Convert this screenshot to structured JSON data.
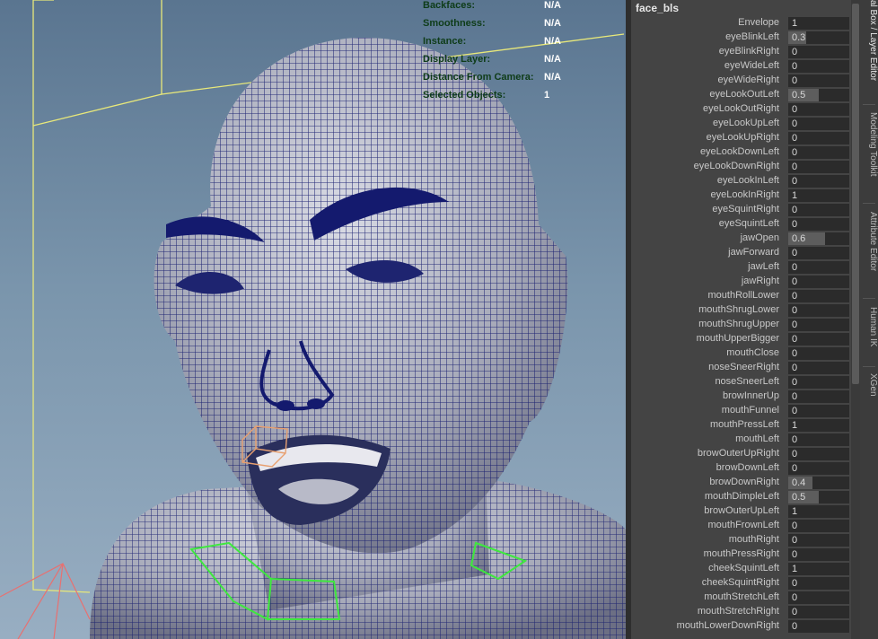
{
  "hud": [
    {
      "label": "Backfaces:",
      "value": "N/A"
    },
    {
      "label": "Smoothness:",
      "value": "N/A"
    },
    {
      "label": "Instance:",
      "value": "N/A"
    },
    {
      "label": "Display Layer:",
      "value": "N/A"
    },
    {
      "label": "Distance From Camera:",
      "value": "N/A"
    },
    {
      "label": "Selected Objects:",
      "value": "1"
    }
  ],
  "panel": {
    "title": "face_bls",
    "attributes": [
      {
        "label": "Envelope",
        "value": "1"
      },
      {
        "label": "eyeBlinkLeft",
        "value": "0.3"
      },
      {
        "label": "eyeBlinkRight",
        "value": "0"
      },
      {
        "label": "eyeWideLeft",
        "value": "0"
      },
      {
        "label": "eyeWideRight",
        "value": "0"
      },
      {
        "label": "eyeLookOutLeft",
        "value": "0.5"
      },
      {
        "label": "eyeLookOutRight",
        "value": "0"
      },
      {
        "label": "eyeLookUpLeft",
        "value": "0"
      },
      {
        "label": "eyeLookUpRight",
        "value": "0"
      },
      {
        "label": "eyeLookDownLeft",
        "value": "0"
      },
      {
        "label": "eyeLookDownRight",
        "value": "0"
      },
      {
        "label": "eyeLookInLeft",
        "value": "0"
      },
      {
        "label": "eyeLookInRight",
        "value": "1"
      },
      {
        "label": "eyeSquintRight",
        "value": "0"
      },
      {
        "label": "eyeSquintLeft",
        "value": "0"
      },
      {
        "label": "jawOpen",
        "value": "0.6"
      },
      {
        "label": "jawForward",
        "value": "0"
      },
      {
        "label": "jawLeft",
        "value": "0"
      },
      {
        "label": "jawRight",
        "value": "0"
      },
      {
        "label": "mouthRollLower",
        "value": "0"
      },
      {
        "label": "mouthShrugLower",
        "value": "0"
      },
      {
        "label": "mouthShrugUpper",
        "value": "0"
      },
      {
        "label": "mouthUpperBigger",
        "value": "0"
      },
      {
        "label": "mouthClose",
        "value": "0"
      },
      {
        "label": "noseSneerRight",
        "value": "0"
      },
      {
        "label": "noseSneerLeft",
        "value": "0"
      },
      {
        "label": "browInnerUp",
        "value": "0"
      },
      {
        "label": "mouthFunnel",
        "value": "0"
      },
      {
        "label": "mouthPressLeft",
        "value": "1"
      },
      {
        "label": "mouthLeft",
        "value": "0"
      },
      {
        "label": "browOuterUpRight",
        "value": "0"
      },
      {
        "label": "browDownLeft",
        "value": "0"
      },
      {
        "label": "browDownRight",
        "value": "0.4"
      },
      {
        "label": "mouthDimpleLeft",
        "value": "0.5"
      },
      {
        "label": "browOuterUpLeft",
        "value": "1"
      },
      {
        "label": "mouthFrownLeft",
        "value": "0"
      },
      {
        "label": "mouthRight",
        "value": "0"
      },
      {
        "label": "mouthPressRight",
        "value": "0"
      },
      {
        "label": "cheekSquintLeft",
        "value": "1"
      },
      {
        "label": "cheekSquintRight",
        "value": "0"
      },
      {
        "label": "mouthStretchLeft",
        "value": "0"
      },
      {
        "label": "mouthStretchRight",
        "value": "0"
      },
      {
        "label": "mouthLowerDownRight",
        "value": "0"
      }
    ]
  },
  "tabs": [
    {
      "label": "al Box / Layer Editor",
      "active": true
    },
    {
      "label": "Modeling Toolkit",
      "active": false
    },
    {
      "label": "Attribute Editor",
      "active": false
    },
    {
      "label": "Human IK",
      "active": false
    },
    {
      "label": "XGen",
      "active": false
    }
  ],
  "colors": {
    "wireframe": "#141a6e",
    "bounding_box": "#e8e87a",
    "hud_label": "#0e3c18",
    "selection_handle": "#e8a070",
    "joint_control": "#3ee83e"
  }
}
